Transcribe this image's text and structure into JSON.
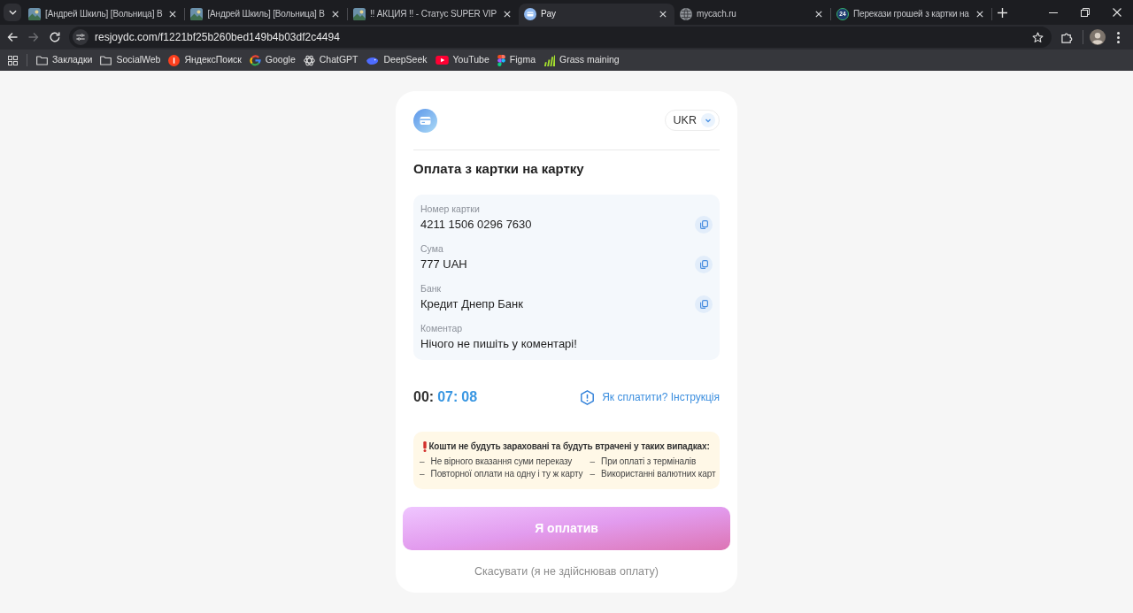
{
  "browser": {
    "tabs": [
      {
        "title": "[Андрей Шкиль] [Вольница] В",
        "selected": false,
        "kind": "image"
      },
      {
        "title": "[Андрей Шкиль] [Вольница] В",
        "selected": false,
        "kind": "image"
      },
      {
        "title": "!! АКЦИЯ !! - Статус SUPER VIP",
        "selected": false,
        "kind": "image"
      },
      {
        "title": "Pay",
        "selected": true,
        "kind": "card"
      },
      {
        "title": "mycach.ru",
        "selected": false,
        "kind": "globe"
      },
      {
        "title": "Перекази грошей з картки на",
        "selected": false,
        "kind": "badge",
        "badge_text": "24"
      }
    ],
    "forward_button": {
      "disabled": true
    },
    "url": "resjoydc.com/f1221bf25b260bed149b4b03df2c4494",
    "bookmarks": [
      {
        "label": "Закладки",
        "kind": "folder"
      },
      {
        "label": "SocialWeb",
        "kind": "folder"
      },
      {
        "label": "ЯндексПоиск",
        "kind": "site"
      },
      {
        "label": "Google",
        "kind": "site"
      },
      {
        "label": "ChatGPT",
        "kind": "site"
      },
      {
        "label": "DeepSeek",
        "kind": "site"
      },
      {
        "label": "YouTube",
        "kind": "site"
      },
      {
        "label": "Figma",
        "kind": "site"
      },
      {
        "label": "Grass maining",
        "kind": "site"
      }
    ]
  },
  "payment": {
    "language": "UKR",
    "title": "Оплата з картки на картку",
    "details": [
      {
        "label": "Номер картки",
        "value": "4211 1506 0296 7630",
        "copyable": true
      },
      {
        "label": "Сума",
        "value": "777 UAH",
        "copyable": true
      },
      {
        "label": "Банк",
        "value": "Кредит Днепр Банк",
        "copyable": true
      },
      {
        "label": "Коментар",
        "value": "Нічого не пишіть у коментарі!",
        "copyable": false
      }
    ],
    "timer": [
      {
        "text": "00:",
        "active": false
      },
      {
        "text": "07:",
        "active": true
      },
      {
        "text": "08",
        "active": true
      }
    ],
    "help_link": "Як сплатити? Інструкція",
    "warning": {
      "title": "Кошти не будуть зараховані та будуть втрачені у таких випадках:",
      "items": [
        {
          "bullet": "–",
          "text": "Не вірного вказання суми переказу"
        },
        {
          "bullet": "–",
          "text": "При оплаті з терміналів"
        },
        {
          "bullet": "–",
          "text": "Повторної оплати на одну і ту ж карту"
        },
        {
          "bullet": "–",
          "text": "Використанні валютних карт"
        }
      ]
    },
    "confirm_button": "Я оплатив",
    "cancel_link": "Скасувати (я не здійснював оплату)"
  }
}
